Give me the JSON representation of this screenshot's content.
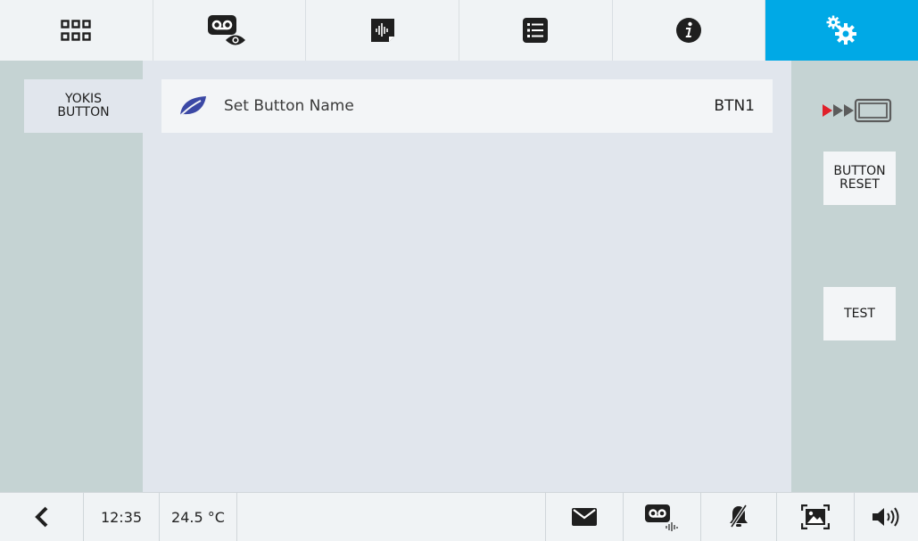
{
  "top_tabs": [
    {
      "name": "apps-grid",
      "icon": "grid-icon"
    },
    {
      "name": "video-monitor",
      "icon": "voicemail-eye-icon"
    },
    {
      "name": "audio-memo",
      "icon": "audio-note-icon"
    },
    {
      "name": "list",
      "icon": "list-icon"
    },
    {
      "name": "info",
      "icon": "info-icon"
    },
    {
      "name": "settings",
      "icon": "settings-gears-icon",
      "active": true
    }
  ],
  "left_panel": {
    "button_label": "YOKIS\nBUTTON"
  },
  "settings_row": {
    "icon": "leaf-icon",
    "label": "Set Button Name",
    "value": "BTN1"
  },
  "right_panel": {
    "skip_icon": "skip-forward-screen-icon",
    "reset_label": "BUTTON\nRESET",
    "test_label": "TEST"
  },
  "status_bar": {
    "back_icon": "chevron-left-icon",
    "time": "12:35",
    "temperature": "24.5 °C",
    "icons": [
      "mail-icon",
      "voicemail-audio-icon",
      "bell-muted-icon",
      "photo-frame-icon",
      "speaker-volume-icon"
    ]
  },
  "colors": {
    "accent": "#00a9e6",
    "leaf": "#3b48a5",
    "skip_red": "#e0202a"
  }
}
